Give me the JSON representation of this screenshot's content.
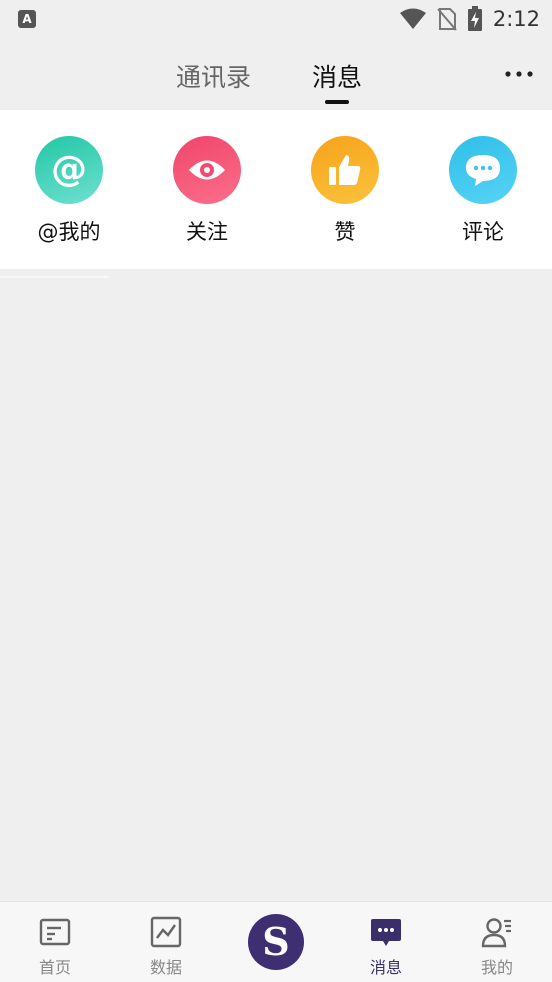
{
  "status_bar": {
    "time": "2:12",
    "app_badge": "A",
    "icons": [
      "wifi-icon",
      "no-sim-icon",
      "battery-charging-icon"
    ]
  },
  "header": {
    "tabs": [
      {
        "label": "通讯录",
        "active": false
      },
      {
        "label": "消息",
        "active": true
      }
    ],
    "more_icon": "more-dots-icon"
  },
  "categories": [
    {
      "label": "@我的",
      "icon": "at-icon",
      "color": "#2ccbb0"
    },
    {
      "label": "关注",
      "icon": "eye-icon",
      "color": "#f5537a"
    },
    {
      "label": "赞",
      "icon": "thumbs-up-icon",
      "color": "#f8ae27"
    },
    {
      "label": "评论",
      "icon": "comment-icon",
      "color": "#3cc6ee"
    }
  ],
  "bottom_nav": {
    "items": [
      {
        "label": "首页",
        "icon": "home-icon",
        "active": false
      },
      {
        "label": "数据",
        "icon": "chart-icon",
        "active": false
      },
      {
        "label": "消息",
        "icon": "message-icon",
        "active": true
      },
      {
        "label": "我的",
        "icon": "profile-icon",
        "active": false
      }
    ],
    "center_button": {
      "glyph": "S",
      "color": "#3d2f72"
    }
  }
}
